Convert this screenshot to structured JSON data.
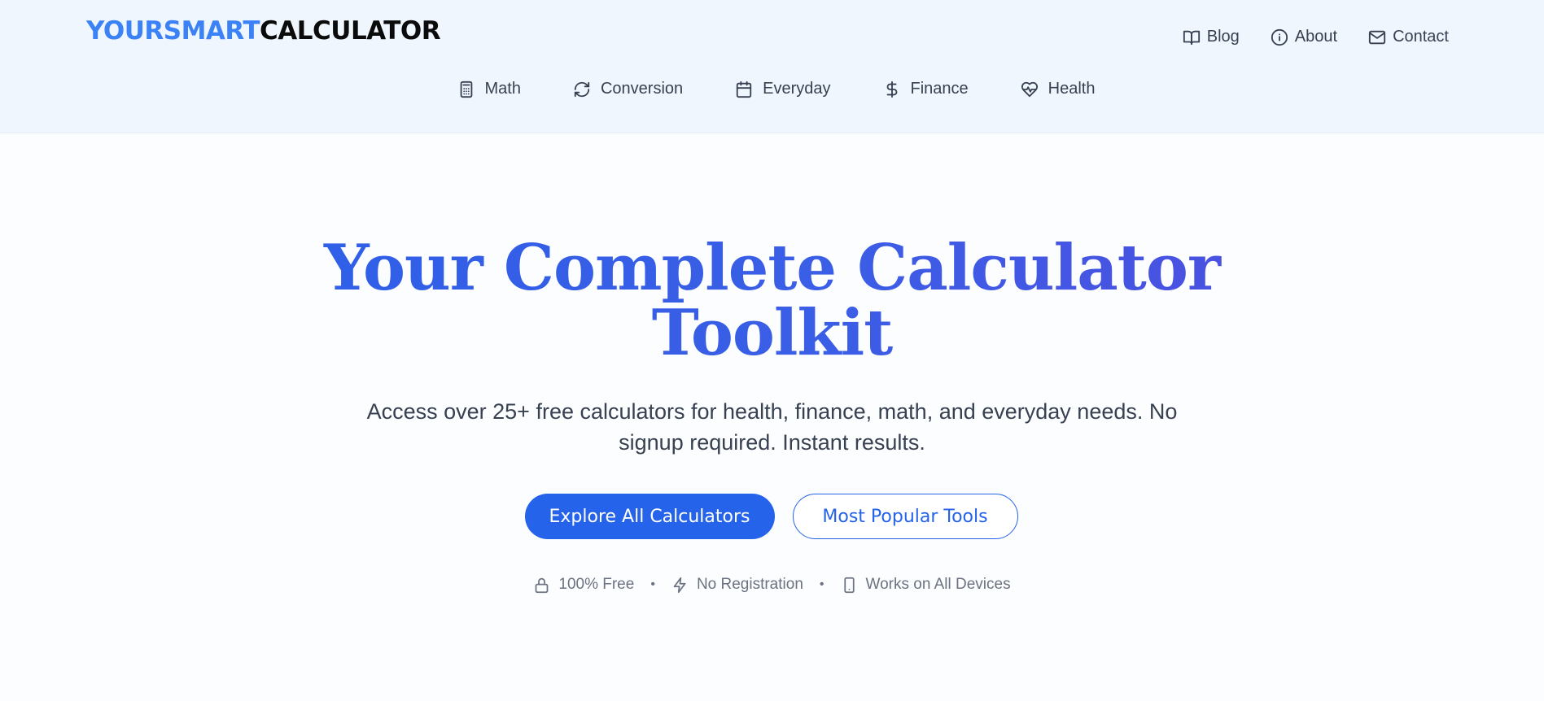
{
  "brand": {
    "logo_part_a": "YOURSMART",
    "logo_part_b": "CALCULATOR",
    "accent_color": "#3b82f6"
  },
  "top_nav": {
    "items": [
      {
        "label": "Blog",
        "icon": "book-open-icon"
      },
      {
        "label": "About",
        "icon": "info-icon"
      },
      {
        "label": "Contact",
        "icon": "mail-icon"
      }
    ]
  },
  "category_nav": {
    "items": [
      {
        "label": "Math",
        "icon": "calculator-icon"
      },
      {
        "label": "Conversion",
        "icon": "refresh-icon"
      },
      {
        "label": "Everyday",
        "icon": "calendar-icon"
      },
      {
        "label": "Finance",
        "icon": "dollar-icon"
      },
      {
        "label": "Health",
        "icon": "heart-pulse-icon"
      }
    ]
  },
  "hero": {
    "title_line1": "Your Complete Calculator",
    "title_line2": "Toolkit",
    "subtitle_line1": "Access over 25+ free calculators for health, finance, math, and everyday needs. No",
    "subtitle_line2": "signup required. Instant results.",
    "primary_cta": "Explore All Calculators",
    "secondary_cta": "Most Popular Tools",
    "primary_color": "#2563eb"
  },
  "features": [
    {
      "label": "100% Free",
      "icon": "lock-icon"
    },
    {
      "label": "No Registration",
      "icon": "zap-icon"
    },
    {
      "label": "Works on All Devices",
      "icon": "smartphone-icon"
    }
  ],
  "separator": "•"
}
